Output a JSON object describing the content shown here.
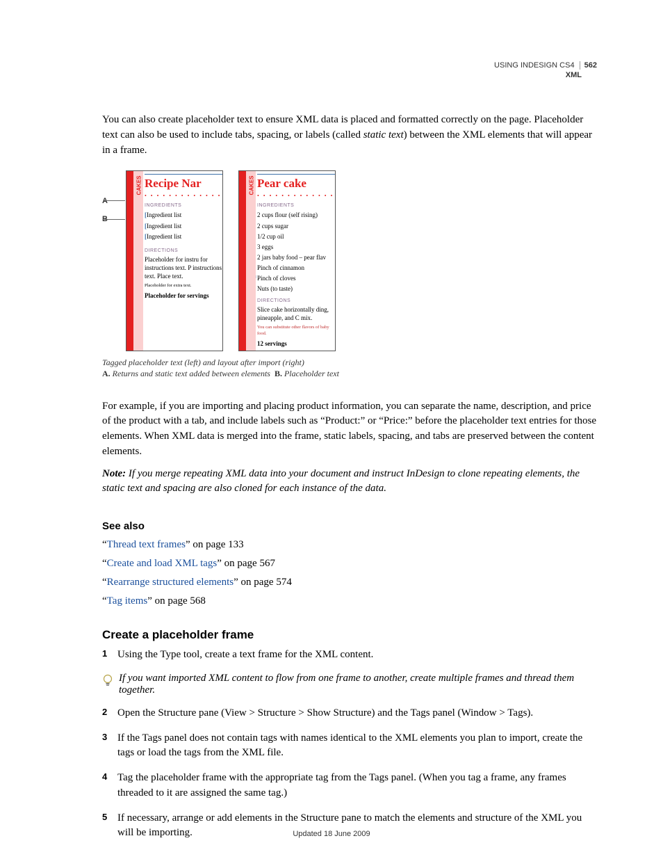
{
  "header": {
    "product": "USING INDESIGN CS4",
    "page_number": "562",
    "section": "XML"
  },
  "intro_paragraph": "You can also create placeholder text to ensure XML data is placed and formatted correctly on the page. Placeholder text can also be used to include tabs, spacing, or labels (called ",
  "intro_italic": "static text",
  "intro_paragraph_end": ") between the XML elements that will appear in a frame.",
  "figure": {
    "label_a": "A",
    "label_b": "B",
    "tab": "CAKES",
    "left": {
      "title": "Recipe Nar",
      "ingredients_heading": "INGREDIENTS",
      "ingredients": [
        "Ingredient list",
        "Ingredient list",
        "Ingredient list"
      ],
      "directions_heading": "DIRECTIONS",
      "directions_text": "Placeholder for instru for instructions text. P instructions text. Place text.",
      "notes": "Placeholder for extra text.",
      "servings": "Placeholder for servings"
    },
    "right": {
      "title": "Pear cake",
      "ingredients_heading": "INGREDIENTS",
      "ingredients": [
        "2 cups flour (self rising)",
        "2 cups sugar",
        "1/2 cup oil",
        "3 eggs",
        "2 jars baby food – pear flav",
        "Pinch of cinnamon",
        "Pinch of cloves",
        "Nuts (to taste)"
      ],
      "directions_heading": "DIRECTIONS",
      "directions_text": "Slice cake horizontally ding, pineapple, and C mix.",
      "notes": "You can substitute other flavors of baby food.",
      "servings": "12 servings"
    }
  },
  "caption": {
    "line1": "Tagged placeholder text (left) and layout after import (right)",
    "a_label": "A.",
    "a_text": "Returns and static text added between elements",
    "b_label": "B.",
    "b_text": "Placeholder text"
  },
  "example_paragraph": "For example, if you are importing and placing product information, you can separate the name, description, and price of the product with a tab, and include labels such as “Product:” or “Price:” before the placeholder text entries for those elements. When XML data is merged into the frame, static labels, spacing, and tabs are preserved between the content elements.",
  "note": {
    "label": "Note:",
    "text": " If you merge repeating XML data into your document and instruct InDesign to clone repeating elements, the static text and spacing are also cloned for each instance of the data."
  },
  "see_also": {
    "heading": "See also",
    "items": [
      {
        "link": "Thread text frames",
        "suffix": "” on page 133"
      },
      {
        "link": "Create and load XML tags",
        "suffix": "” on page 567"
      },
      {
        "link": "Rearrange structured elements",
        "suffix": "” on page 574"
      },
      {
        "link": "Tag items",
        "suffix": "” on page 568"
      }
    ]
  },
  "create_placeholder": {
    "heading": "Create a placeholder frame",
    "steps": [
      "Using the Type tool, create a text frame for the XML content.",
      "Open the Structure pane (View > Structure > Show Structure) and the Tags panel (Window > Tags).",
      "If the Tags panel does not contain tags with names identical to the XML elements you plan to import, create the tags or load the tags from the XML file.",
      "Tag the placeholder frame with the appropriate tag from the Tags panel. (When you tag a frame, any frames threaded to it are assigned the same tag.)",
      "If necessary, arrange or add elements in the Structure pane to match the elements and structure of the XML you will be importing."
    ],
    "tip": "If you want imported XML content to flow from one frame to another, create multiple frames and thread them together."
  },
  "footer": "Updated 18 June 2009"
}
